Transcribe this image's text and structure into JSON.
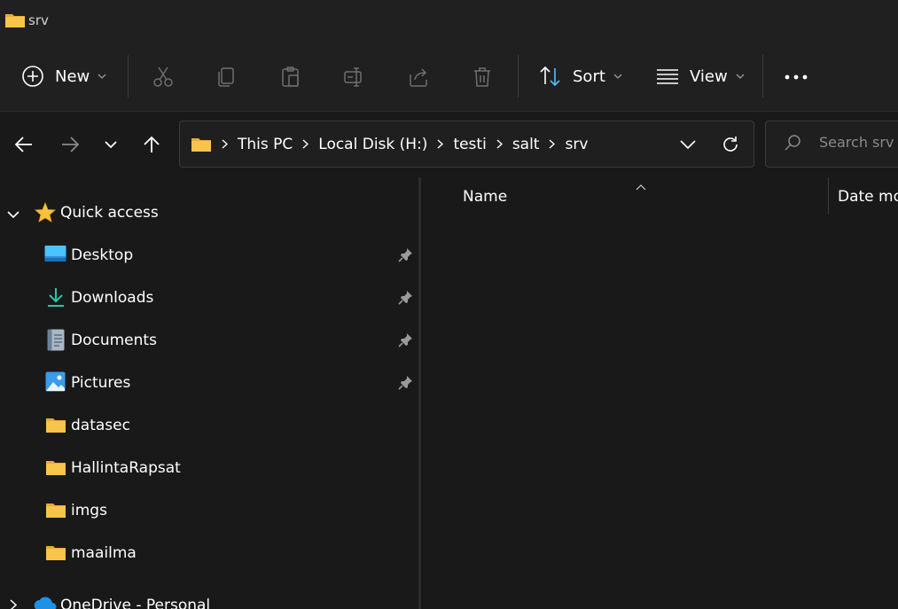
{
  "window": {
    "title": "srv"
  },
  "toolbar": {
    "new_label": "New",
    "sort_label": "Sort",
    "view_label": "View",
    "icons": [
      "cut-icon",
      "copy-icon",
      "paste-icon",
      "rename-icon",
      "share-icon",
      "delete-icon",
      "more-icon"
    ]
  },
  "address": {
    "crumbs": [
      "This PC",
      "Local Disk (H:)",
      "testi",
      "salt",
      "srv"
    ]
  },
  "search": {
    "placeholder": "Search srv"
  },
  "sidebar": {
    "quick_access_label": "Quick access",
    "items": [
      {
        "label": "Desktop",
        "icon": "desktop-icon",
        "pinned": true
      },
      {
        "label": "Downloads",
        "icon": "downloads-icon",
        "pinned": true
      },
      {
        "label": "Documents",
        "icon": "documents-icon",
        "pinned": true
      },
      {
        "label": "Pictures",
        "icon": "pictures-icon",
        "pinned": true
      },
      {
        "label": "datasec",
        "icon": "folder-icon",
        "pinned": false
      },
      {
        "label": "HallintaRapsat",
        "icon": "folder-icon",
        "pinned": false
      },
      {
        "label": "imgs",
        "icon": "folder-icon",
        "pinned": false
      },
      {
        "label": "maailma",
        "icon": "folder-icon",
        "pinned": false
      }
    ],
    "onedrive_label": "OneDrive - Personal"
  },
  "columns": {
    "name": "Name",
    "date_modified": "Date mo"
  },
  "colors": {
    "background": "#191919",
    "chrome": "#202020",
    "folder": "#F8C44B",
    "accent": "#4CC2FF"
  }
}
